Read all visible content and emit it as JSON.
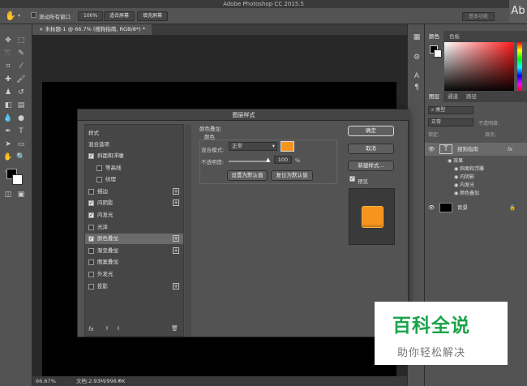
{
  "app_title": "Adobe Photoshop CC 2015.5",
  "options_bar": {
    "scroll_all": "滚动所有窗口",
    "zoom_100": "100%",
    "fit_screen": "适合屏幕",
    "fill_screen": "填充屏幕",
    "workspace": "基本功能",
    "ab_badge": "Ab"
  },
  "document": {
    "tab_title": "未标题-1 @ 66.7% (搜狗指南, RGB/8*) *",
    "zoom": "66.67%",
    "doc_size": "文档:2.93M/998.0K"
  },
  "color_panel": {
    "tabs": [
      "颜色",
      "色板"
    ]
  },
  "layers_panel": {
    "tabs": [
      "图层",
      "通道",
      "路径"
    ],
    "filter_label": "类型",
    "mode": "正常",
    "opacity_label": "不透明度:",
    "lock_label": "锁定:",
    "fill_label": "填充:",
    "layers": [
      {
        "name": "搜狗指南",
        "fx": "fx",
        "thumb": "T"
      },
      {
        "name": "背景"
      }
    ],
    "effects_label": "效果",
    "effects": [
      "斜面和浮雕",
      "内阴影",
      "内发光",
      "颜色叠加"
    ]
  },
  "dialog": {
    "title": "图层样式",
    "styles_header": "样式",
    "blend_options": "混合选项",
    "items": [
      {
        "label": "斜面和浮雕",
        "checked": true,
        "plus": false,
        "indent": false
      },
      {
        "label": "等高线",
        "checked": false,
        "plus": false,
        "indent": true
      },
      {
        "label": "纹理",
        "checked": false,
        "plus": false,
        "indent": true
      },
      {
        "label": "描边",
        "checked": false,
        "plus": true,
        "indent": false
      },
      {
        "label": "内阴影",
        "checked": true,
        "plus": true,
        "indent": false
      },
      {
        "label": "内发光",
        "checked": true,
        "plus": false,
        "indent": false
      },
      {
        "label": "光泽",
        "checked": false,
        "plus": false,
        "indent": false
      },
      {
        "label": "颜色叠加",
        "checked": true,
        "plus": true,
        "indent": false,
        "selected": true
      },
      {
        "label": "渐变叠加",
        "checked": false,
        "plus": true,
        "indent": false
      },
      {
        "label": "图案叠加",
        "checked": false,
        "plus": false,
        "indent": false
      },
      {
        "label": "外发光",
        "checked": false,
        "plus": false,
        "indent": false
      },
      {
        "label": "投影",
        "checked": false,
        "plus": true,
        "indent": false
      }
    ],
    "section_title": "颜色叠加",
    "section_sub": "颜色",
    "blend_mode_label": "混合模式:",
    "blend_mode_value": "正常",
    "opacity_label": "不透明度:",
    "opacity_value": "100",
    "opacity_unit": "%",
    "overlay_color": "#f7941d",
    "set_default": "设置为默认值",
    "reset_default": "复位为默认值",
    "ok": "确定",
    "cancel": "取消",
    "new_style": "新建样式...",
    "preview_label": "预览",
    "preview_checked": true,
    "fx_label": "fx"
  },
  "watermark": {
    "title": "百科全说",
    "subtitle": "助你轻松解决"
  },
  "colors": {
    "accent_orange": "#f7941d",
    "panel_bg": "#535353",
    "dark_bg": "#282828"
  }
}
